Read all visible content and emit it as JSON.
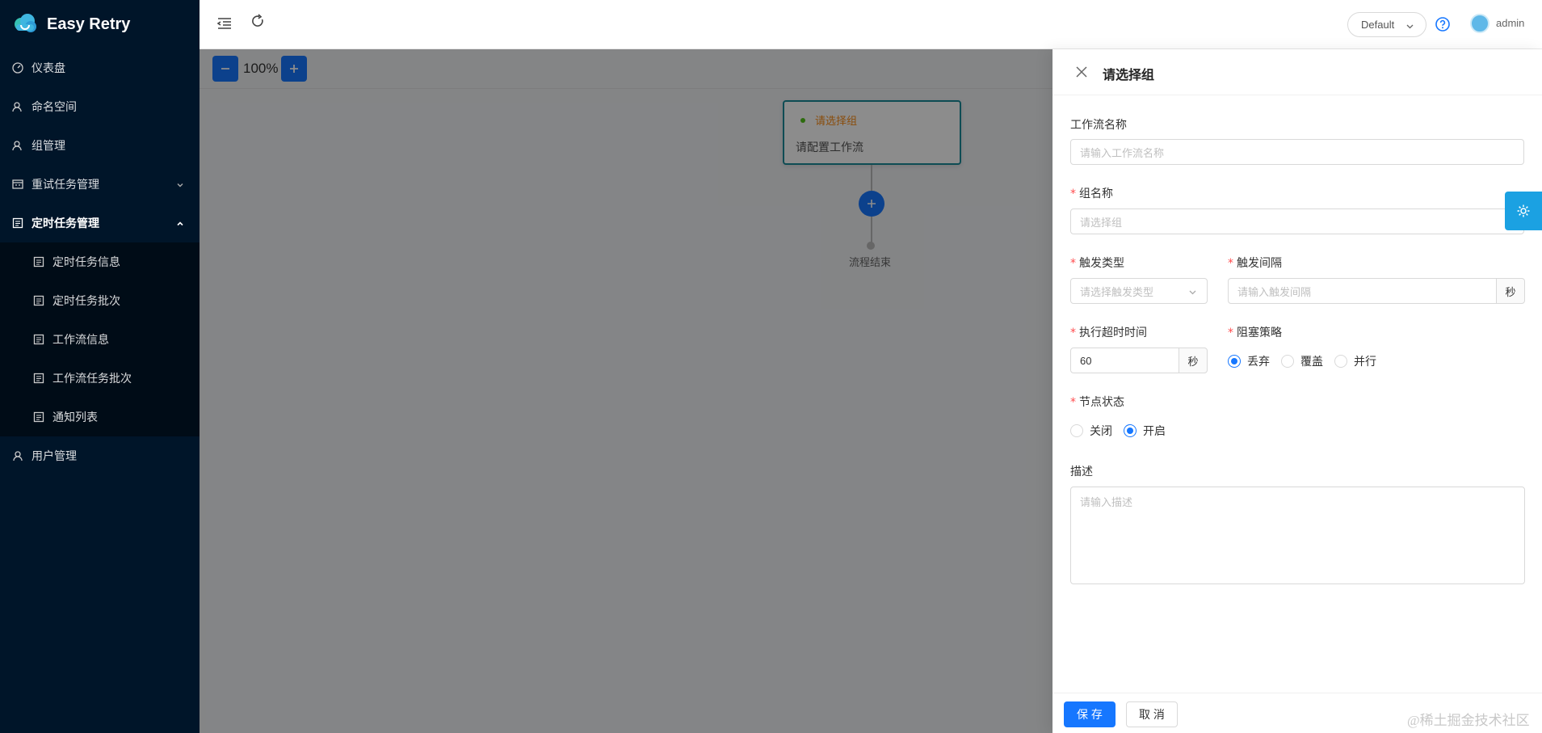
{
  "app": {
    "title": "Easy Retry"
  },
  "sidebar": {
    "items": [
      {
        "label": "仪表盘",
        "icon": "dashboard-icon"
      },
      {
        "label": "命名空间",
        "icon": "user-icon"
      },
      {
        "label": "组管理",
        "icon": "user-icon"
      },
      {
        "label": "重试任务管理",
        "icon": "calendar-icon",
        "expanded": false
      },
      {
        "label": "定时任务管理",
        "icon": "list-icon",
        "expanded": true
      },
      {
        "label": "用户管理",
        "icon": "user-icon"
      }
    ],
    "submenu": [
      {
        "label": "定时任务信息"
      },
      {
        "label": "定时任务批次"
      },
      {
        "label": "工作流信息"
      },
      {
        "label": "工作流任务批次"
      },
      {
        "label": "通知列表"
      }
    ]
  },
  "header": {
    "namespace": "Default",
    "username": "admin"
  },
  "canvas": {
    "zoom": "100%",
    "node_title": "请选择组",
    "node_desc": "请配置工作流",
    "end_label": "流程结束"
  },
  "drawer": {
    "title": "请选择组",
    "workflow_name_label": "工作流名称",
    "workflow_name_placeholder": "请输入工作流名称",
    "group_label": "组名称",
    "group_placeholder": "请选择组",
    "trigger_type_label": "触发类型",
    "trigger_type_placeholder": "请选择触发类型",
    "trigger_interval_label": "触发间隔",
    "trigger_interval_placeholder": "请输入触发间隔",
    "trigger_interval_unit": "秒",
    "timeout_label": "执行超时时间",
    "timeout_value": "60",
    "timeout_unit": "秒",
    "block_strategy_label": "阻塞策略",
    "block_strategy_options": [
      "丢弃",
      "覆盖",
      "并行"
    ],
    "block_strategy_selected": "丢弃",
    "node_status_label": "节点状态",
    "node_status_options": [
      "关闭",
      "开启"
    ],
    "node_status_selected": "开启",
    "description_label": "描述",
    "description_placeholder": "请输入描述",
    "save_label": "保 存",
    "cancel_label": "取 消"
  },
  "watermark": "@稀土掘金技术社区",
  "colors": {
    "primary": "#1677ff",
    "sidebar_bg": "#001529",
    "node_title": "#fa8c16",
    "required": "#ff4d4f"
  }
}
